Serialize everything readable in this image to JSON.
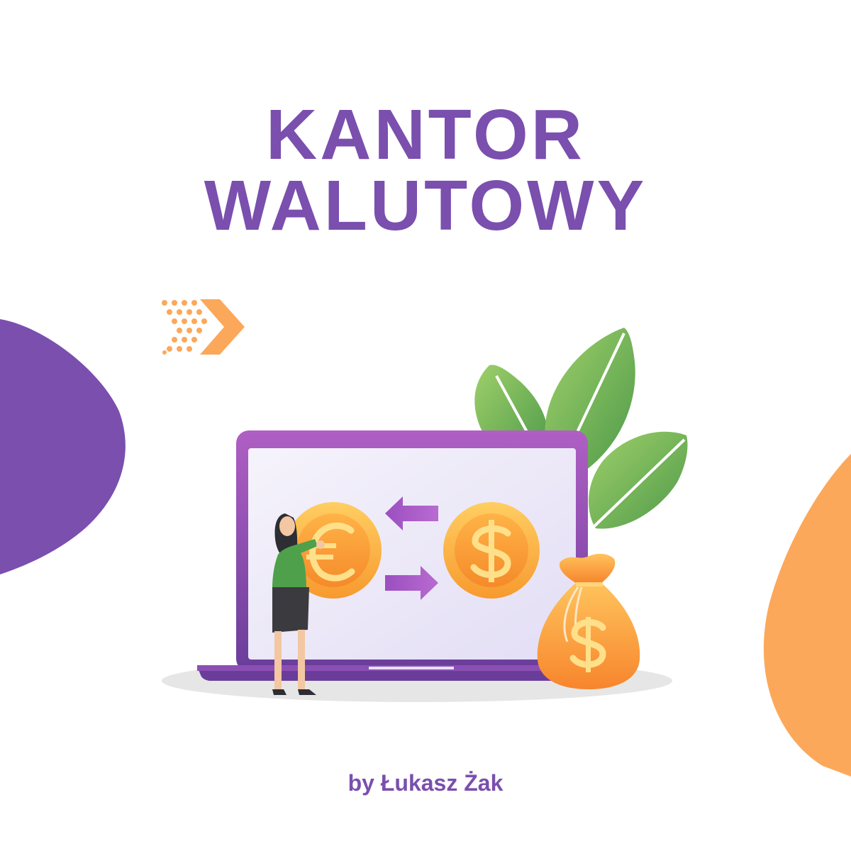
{
  "title": {
    "line1": "KANTOR",
    "line2": "WALUTOWY"
  },
  "byline": "by Łukasz Żak",
  "illustration": {
    "left_coin_icon": "euro-icon",
    "right_coin_icon": "dollar-icon",
    "bag_icon": "dollar-icon",
    "arrows": [
      "arrow-left-icon",
      "arrow-right-icon"
    ]
  },
  "colors": {
    "brand_purple": "#7a4fae",
    "accent_orange": "#fca85a",
    "coin_gold": "#fbb03b",
    "leaf_green": "#6db25a"
  }
}
